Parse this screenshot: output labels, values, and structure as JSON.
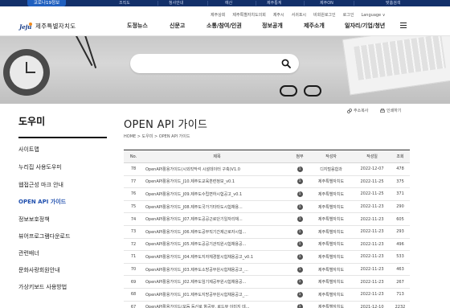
{
  "quickbar": {
    "badge": "코로나19정보",
    "links": [
      "조직도",
      "청사안내",
      "예산",
      "제주통계",
      "제주ON",
      "맞춤검색"
    ]
  },
  "utility_links": [
    "제주상회",
    "제주특별자치도의회",
    "제주시",
    "서귀포시",
    "비회원로그인",
    "로그인",
    "Language ∨"
  ],
  "logo": {
    "mark": "Jeju",
    "text": "제주특별자치도"
  },
  "gnb": [
    "도정뉴스",
    "신문고",
    "소통/참여/인권",
    "정보공개",
    "제주소개",
    "일자리/기업/청년"
  ],
  "hero": {
    "search_placeholder": ""
  },
  "sidebar": {
    "title": "도우미",
    "items": [
      "사이트맵",
      "누리집 사용도우미",
      "웹접근성 마크 안내",
      "OPEN API 가이드",
      "정보보호정책",
      "뷰어프로그램다운로드",
      "관련배너",
      "문화사랑회원안내",
      "가상키보드 사용방법"
    ],
    "active_index": 3
  },
  "content": {
    "title": "OPEN API 가이드",
    "address_copy": "주소복사",
    "print": "인쇄하기",
    "breadcrumb": [
      "HOME",
      "도우미",
      "OPEN API 가이드"
    ]
  },
  "table": {
    "headers": [
      "No.",
      "제목",
      "첨부",
      "작성자",
      "작성일",
      "조회"
    ],
    "rows": [
      {
        "no": "78",
        "title": "OpenAPI활용가이드(시외직막석 시설데이터 구축)V1.0",
        "att": "1",
        "author": "디지털융합과",
        "date": "2022-12-07",
        "views": "478"
      },
      {
        "no": "77",
        "title": "OpenAPI활용가이드_J10.제주도교육훈련정보_v0.1",
        "att": "1",
        "author": "제주특별자치도",
        "date": "2022-11-25",
        "views": "375"
      },
      {
        "no": "76",
        "title": "OpenAPI활용가이드_J09.제주도수립변하시험공고_v0.1",
        "att": "1",
        "author": "제주특별자치도",
        "date": "2022-11-25",
        "views": "371"
      },
      {
        "no": "75",
        "title": "OpenAPI활용가이드_J08.제주도국가기타타도시험채용...",
        "att": "1",
        "author": "제주특별자치도",
        "date": "2022-11-23",
        "views": "290"
      },
      {
        "no": "74",
        "title": "OpenAPI활용가이드_J07.제주도공공근로단기일자리채...",
        "att": "1",
        "author": "제주특별자치도",
        "date": "2022-11-23",
        "views": "605"
      },
      {
        "no": "73",
        "title": "OpenAPI활용가이드_J06.제주도공무직기간제근로자시험...",
        "att": "1",
        "author": "제주특별자치도",
        "date": "2022-11-23",
        "views": "293"
      },
      {
        "no": "72",
        "title": "OpenAPI활용가이드_J05.제주도공공기관직원시험채용공...",
        "att": "1",
        "author": "제주특별자치도",
        "date": "2022-11-23",
        "views": "496"
      },
      {
        "no": "71",
        "title": "OpenAPI활용가이드_J04.제주도지자체경찰시험채용공고_v0.1",
        "att": "1",
        "author": "제주특별자치도",
        "date": "2022-11-23",
        "views": "533"
      },
      {
        "no": "70",
        "title": "OpenAPI활용가이드_J03.제주도소방공무원시험채용공고_...",
        "att": "1",
        "author": "제주특별자치도",
        "date": "2022-11-23",
        "views": "463"
      },
      {
        "no": "69",
        "title": "OpenAPI활용가이드_J02.제주도임기제공무원시험채용공...",
        "att": "1",
        "author": "제주특별자치도",
        "date": "2022-11-23",
        "views": "267"
      },
      {
        "no": "68",
        "title": "OpenAPI활용가이드_J01.제주도지방공무원시험채용공고_...",
        "att": "1",
        "author": "제주특별자치도",
        "date": "2022-11-23",
        "views": "713"
      },
      {
        "no": "67",
        "title": "OpenAPI활용가이드(모듬 등산로 항공뷰, 로드뷰 이미지 데...",
        "att": "1",
        "author": "제주특별자치도",
        "date": "2021-12-10",
        "views": "2232"
      }
    ]
  }
}
